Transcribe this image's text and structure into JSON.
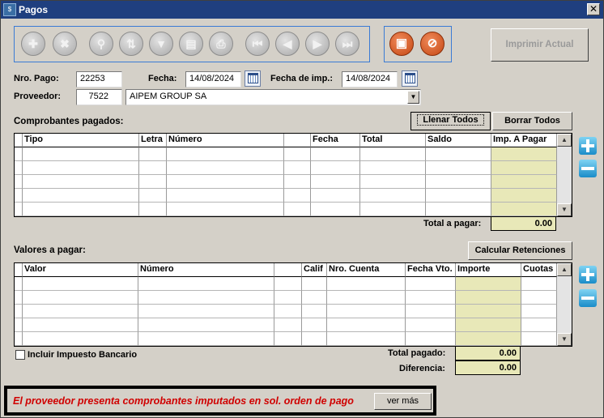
{
  "window": {
    "title": "Pagos",
    "app_icon": "pagos-app-icon",
    "close_glyph": "✕"
  },
  "toolbar": {
    "nav_icons": [
      "add-icon",
      "delete-icon",
      "search-icon",
      "sort-az-icon",
      "filter-icon",
      "document-icon",
      "print-icon",
      "first-record-icon",
      "previous-record-icon",
      "next-record-icon",
      "last-record-icon"
    ],
    "nav_glyphs": [
      "✚",
      "✖",
      "⚲",
      "⇅",
      "▼",
      "▤",
      "⎙",
      "⏮",
      "◀",
      "▶",
      "⏭"
    ],
    "save_glyph": "▣",
    "cancel_glyph": "⊘",
    "print_label": "Imprimir Actual"
  },
  "form": {
    "nro_pago_label": "Nro. Pago:",
    "nro_pago_value": "22253",
    "fecha_label": "Fecha:",
    "fecha_value": "14/08/2024",
    "fecha_imp_label": "Fecha de imp.:",
    "fecha_imp_value": "14/08/2024",
    "proveedor_label": "Proveedor:",
    "proveedor_code": "7522",
    "proveedor_name": "AIPEM GROUP SA",
    "dropdown_glyph": "▼"
  },
  "comprobantes": {
    "section_label": "Comprobantes pagados:",
    "fill_all_label": "Llenar Todos",
    "clear_all_label": "Borrar Todos",
    "columns": [
      "Tipo",
      "Letra",
      "Número",
      "",
      "Fecha",
      "Total",
      "Saldo",
      "Imp. A Pagar"
    ],
    "total_label": "Total a pagar:",
    "total_value": "0.00"
  },
  "valores": {
    "section_label": "Valores a pagar:",
    "calc_label": "Calcular Retenciones",
    "columns": [
      "Valor",
      "Número",
      "",
      "Calif",
      "Nro. Cuenta",
      "Fecha Vto.",
      "Importe",
      "Cuotas"
    ],
    "bank_tax_label": "Incluir Impuesto Bancario",
    "total_pagado_label": "Total pagado:",
    "total_pagado_value": "0.00",
    "diferencia_label": "Diferencia:",
    "diferencia_value": "0.00"
  },
  "alert": {
    "message": "El proveedor presenta comprobantes imputados en sol. orden de pago",
    "button_label": "ver más"
  },
  "colors": {
    "titlebar": "#1f3f7f",
    "alert_text": "#d00000",
    "highlight_column": "#e8e8b8",
    "action_orange": "#d65a22",
    "add_remove_blue": "#1b8cc8"
  }
}
